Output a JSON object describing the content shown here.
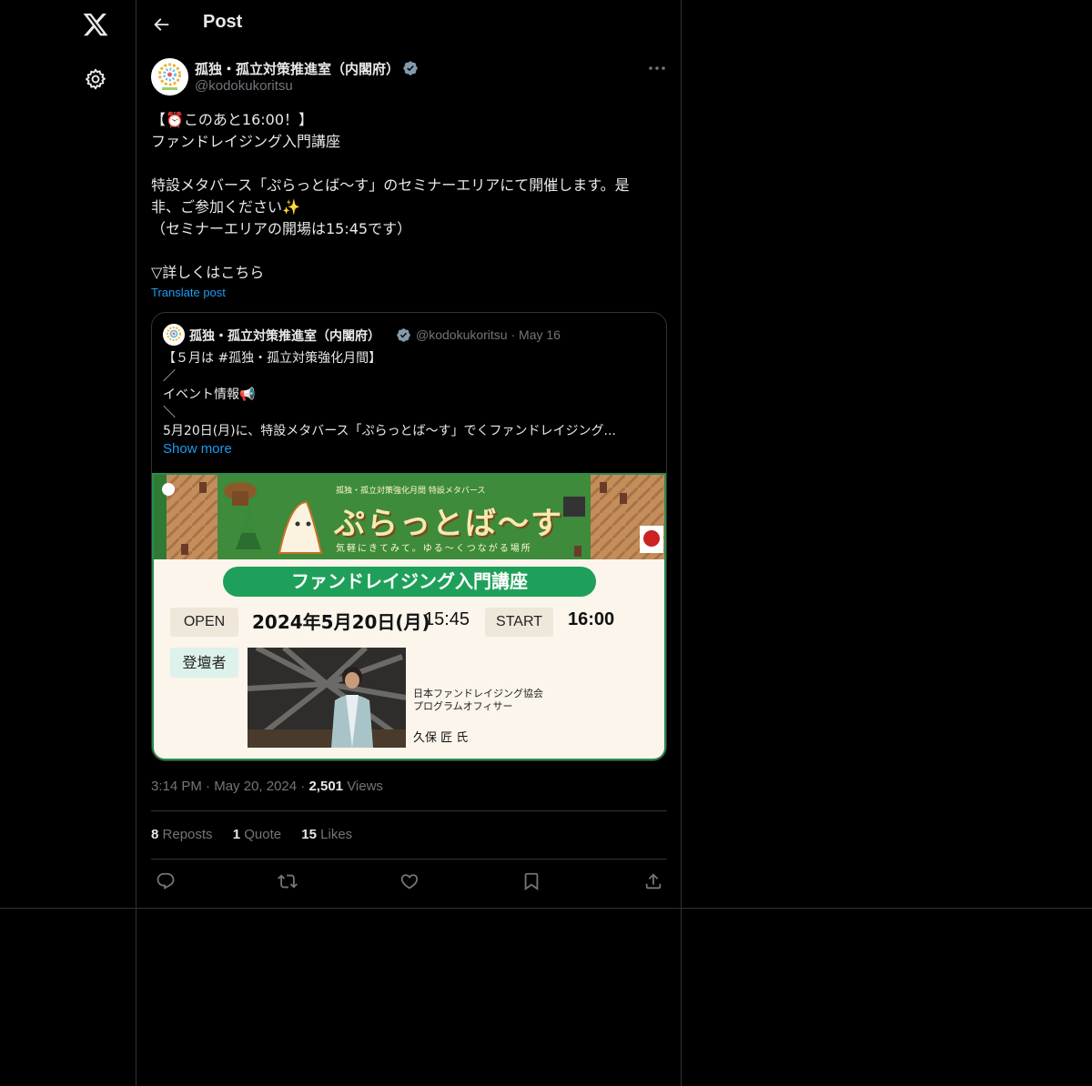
{
  "header": {
    "title": "Post"
  },
  "post": {
    "author_name": "孤独・孤立対策推進室（内閣府）",
    "handle": "@kodokukoritsu",
    "text_lines": [
      "【⏰このあと16:00！】",
      "ファンドレイジング入門講座",
      "",
      "特設メタバース「ぷらっとば〜す」のセミナーエリアにて開催します。是",
      "非、ご参加ください✨",
      "（セミナーエリアの開場は15:45です）",
      "",
      "▽詳しくはこちら"
    ],
    "translate_label": "Translate post",
    "time": "3:14 PM",
    "date": "May 20, 2024",
    "views_count": "2,501",
    "views_label": "Views"
  },
  "quote": {
    "author_name": "孤独・孤立対策推進室（内閣府）",
    "handle": "@kodokukoritsu",
    "date": "May 16",
    "text_lines": [
      "【５月は #孤独・孤立対策強化月間】",
      "／",
      "イベント情報📢",
      "＼",
      "5月20日(月)に、特設メタバース「ぷらっとば〜す」でくファンドレイジング..."
    ],
    "show_more": "Show more",
    "image": {
      "subtitle": "孤独・孤立対策強化月間 特設メタバース",
      "logo": "ぷらっとば〜す",
      "tagline": "気軽にきてみて。ゆる〜くつながる場所",
      "event_title": "ファンドレイジング入門講座",
      "open_label": "OPEN",
      "date": "2024年5月20日(月)",
      "open_time": "15:45",
      "start_label": "START",
      "start_time": "16:00",
      "speaker_label": "登壇者",
      "org_line1": "日本ファンドレイジング協会",
      "org_line2": "プログラムオフィサー",
      "speaker_name": "久保 匠 氏"
    }
  },
  "stats": {
    "reposts_count": "8",
    "reposts_label": "Reposts",
    "quotes_count": "1",
    "quotes_label": "Quote",
    "likes_count": "15",
    "likes_label": "Likes"
  },
  "icons": [
    "x-logo-icon",
    "settings-icon",
    "back-arrow-icon",
    "verified-badge-icon",
    "more-icon",
    "reply-icon",
    "repost-icon",
    "like-icon",
    "bookmark-icon",
    "share-icon"
  ],
  "colors": {
    "background": "#000000",
    "text": "#e7e9ea",
    "muted": "#71767b",
    "link": "#1d9bf0",
    "border": "#2f3336"
  }
}
